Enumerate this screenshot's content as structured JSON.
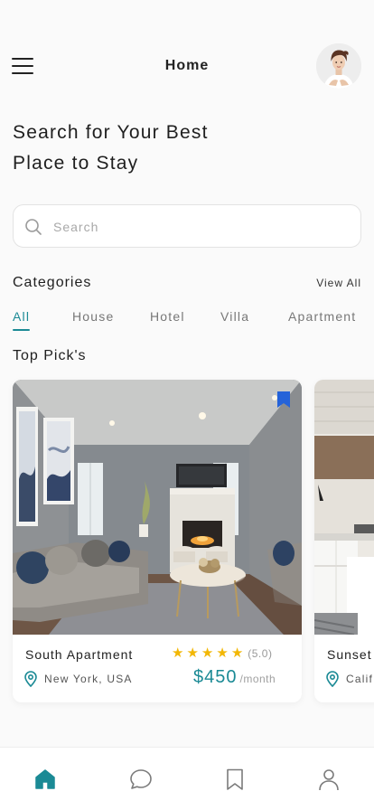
{
  "header": {
    "title": "Home"
  },
  "headline": {
    "line1": "Search for Your Best",
    "line2": "Place to Stay"
  },
  "search": {
    "placeholder": "Search",
    "value": ""
  },
  "categories": {
    "title": "Categories",
    "view_all": "View All",
    "tabs": [
      {
        "label": "All",
        "active": true
      },
      {
        "label": "House",
        "active": false
      },
      {
        "label": "Hotel",
        "active": false
      },
      {
        "label": "Villa",
        "active": false
      },
      {
        "label": "Apartment",
        "active": false
      }
    ]
  },
  "top_picks": {
    "title": "Top Pick's",
    "cards": [
      {
        "name": "South Apartment",
        "rating_stars": 5,
        "rating": "(5.0)",
        "location": "New York, USA",
        "price": "$450",
        "price_unit": "/month",
        "bookmarked": true
      },
      {
        "name": "Sunset",
        "location": "Calif"
      }
    ]
  },
  "colors": {
    "accent": "#1b8a95",
    "star": "#f2b705",
    "bookmark": "#2563d9"
  },
  "bottom_nav": [
    {
      "icon": "home-icon",
      "active": true
    },
    {
      "icon": "chat-icon",
      "active": false
    },
    {
      "icon": "bookmark-icon",
      "active": false
    },
    {
      "icon": "profile-icon",
      "active": false
    }
  ]
}
